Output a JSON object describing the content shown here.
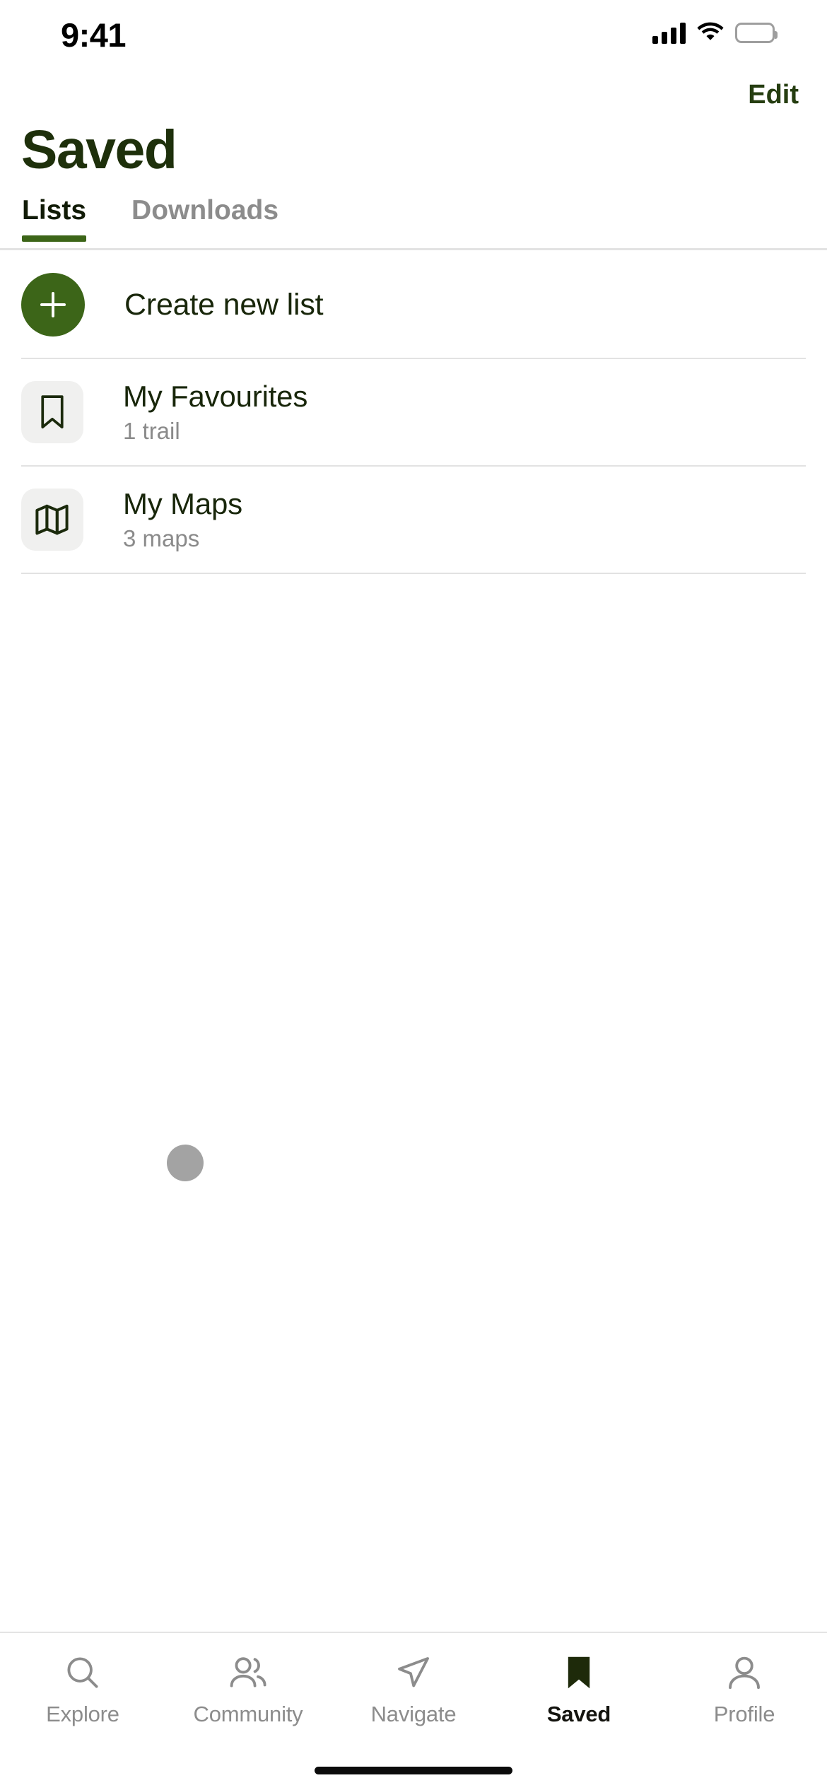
{
  "status_bar": {
    "time": "9:41",
    "icons": [
      "cellular-signal-icon",
      "wifi-icon",
      "battery-icon"
    ]
  },
  "header": {
    "edit_label": "Edit",
    "title": "Saved"
  },
  "tabs": [
    {
      "label": "Lists",
      "active": true
    },
    {
      "label": "Downloads",
      "active": false
    }
  ],
  "list": {
    "create": {
      "label": "Create new list",
      "icon": "plus-icon"
    },
    "items": [
      {
        "title": "My Favourites",
        "subtitle": "1 trail",
        "icon": "bookmark-outline-icon"
      },
      {
        "title": "My Maps",
        "subtitle": "3 maps",
        "icon": "map-folded-icon"
      }
    ]
  },
  "bottom_nav": [
    {
      "label": "Explore",
      "icon": "search-icon",
      "active": false
    },
    {
      "label": "Community",
      "icon": "people-icon",
      "active": false
    },
    {
      "label": "Navigate",
      "icon": "navigate-arrow-icon",
      "active": false
    },
    {
      "label": "Saved",
      "icon": "bookmark-filled-icon",
      "active": true
    },
    {
      "label": "Profile",
      "icon": "person-icon",
      "active": false
    }
  ],
  "colors": {
    "brand_green": "#3c6518",
    "title_green": "#1e300b",
    "text_dark": "#18260a",
    "text_muted": "#8a8a8a",
    "tile_bg": "#f0f0ef",
    "divider": "#e2e2e2",
    "loading_dot": "#a3a3a3"
  }
}
